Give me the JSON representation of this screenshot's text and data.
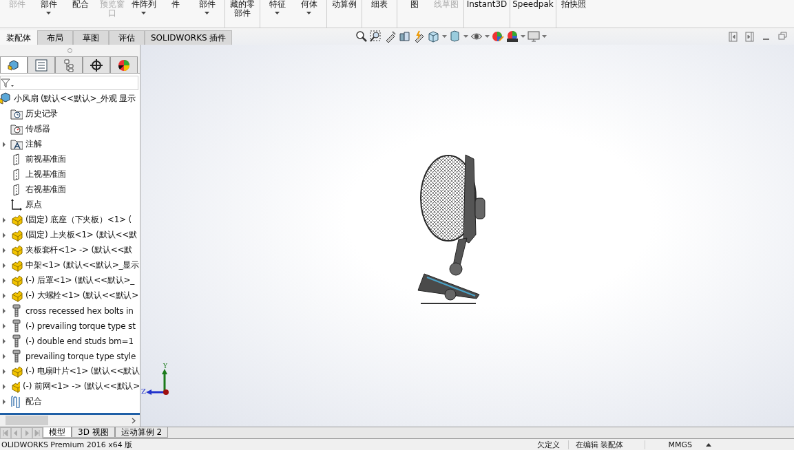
{
  "ribbon": [
    {
      "label": "部件",
      "disabled": true,
      "caret": false
    },
    {
      "label": "部件",
      "disabled": false,
      "caret": true
    },
    {
      "label": "配合",
      "disabled": false,
      "caret": false
    },
    {
      "label": "预览窗口",
      "disabled": true,
      "caret": false
    },
    {
      "label": "件阵列",
      "disabled": false,
      "caret": true
    },
    {
      "label": "件",
      "disabled": false,
      "caret": false
    },
    {
      "label": "部件",
      "disabled": false,
      "caret": true
    },
    {
      "label": "藏的零部件",
      "disabled": false,
      "caret": false
    },
    {
      "label": "特征",
      "disabled": false,
      "caret": true
    },
    {
      "label": "何体",
      "disabled": false,
      "caret": true
    },
    {
      "label": "动算例",
      "disabled": false,
      "caret": false
    },
    {
      "label": "细表",
      "disabled": false,
      "caret": false
    },
    {
      "label": "图",
      "disabled": false,
      "caret": false
    },
    {
      "label": "线草图",
      "disabled": true,
      "caret": false
    },
    {
      "label": "Instant3D",
      "disabled": false,
      "caret": false
    },
    {
      "label": "Speedpak",
      "disabled": false,
      "caret": false
    },
    {
      "label": "拍快照",
      "disabled": false,
      "caret": false
    }
  ],
  "command_tabs": [
    {
      "label": "装配体",
      "selected": true
    },
    {
      "label": "布局",
      "selected": false
    },
    {
      "label": "草图",
      "selected": false
    },
    {
      "label": "评估",
      "selected": false
    },
    {
      "label": "SOLIDWORKS 插件",
      "selected": false
    }
  ],
  "panel_tabs": [
    {
      "kind": "feature",
      "selected": true
    },
    {
      "kind": "property",
      "selected": false
    },
    {
      "kind": "config",
      "selected": false
    },
    {
      "kind": "dim",
      "selected": false
    },
    {
      "kind": "display",
      "selected": false
    }
  ],
  "tree": [
    {
      "kind": "assembly",
      "label": "小风扇  (默认<<默认>_外观 显示"
    },
    {
      "kind": "history",
      "label": "历史记录"
    },
    {
      "kind": "sensor",
      "label": "传感器"
    },
    {
      "kind": "annotation",
      "label": "注解",
      "expanded": false
    },
    {
      "kind": "plane",
      "label": "前视基准面"
    },
    {
      "kind": "plane",
      "label": "上视基准面"
    },
    {
      "kind": "plane",
      "label": "右视基准面"
    },
    {
      "kind": "origin",
      "label": "原点"
    },
    {
      "kind": "part",
      "label": "(固定) 底座（下夹板）<1> (",
      "expanded": false
    },
    {
      "kind": "part",
      "label": "(固定) 上夹板<1> (默认<<默",
      "expanded": false
    },
    {
      "kind": "part",
      "label": "夹板套杆<1> -> (默认<<默",
      "expanded": false
    },
    {
      "kind": "part",
      "label": "中架<1> (默认<<默认>_显示",
      "expanded": false
    },
    {
      "kind": "part",
      "label": "(-) 后罩<1> (默认<<默认>_",
      "expanded": false
    },
    {
      "kind": "part",
      "label": "(-) 大螺栓<1> (默认<<默认>",
      "expanded": false
    },
    {
      "kind": "bolt",
      "label": "cross recessed hex bolts in",
      "expanded": false
    },
    {
      "kind": "bolt",
      "label": "(-) prevailing torque type st",
      "expanded": false
    },
    {
      "kind": "bolt",
      "label": "(-) double end studs bm=1",
      "expanded": false
    },
    {
      "kind": "bolt",
      "label": "prevailing torque type style",
      "expanded": false
    },
    {
      "kind": "part",
      "label": "(-) 电扇叶片<1> (默认<<默认",
      "expanded": false
    },
    {
      "kind": "part",
      "label": "(-) 前网<1> -> (默认<<默认>",
      "expanded": false
    },
    {
      "kind": "mate",
      "label": "配合",
      "expanded": false
    }
  ],
  "triad": {
    "y": "Y",
    "z": "Z"
  },
  "bottom_tabs": [
    {
      "label": "模型",
      "selected": true
    },
    {
      "label": "3D 视图",
      "selected": false
    },
    {
      "label": "运动算例 2",
      "selected": false
    }
  ],
  "status_bar": [
    "OLIDWORKS Premium 2016 x64 版",
    "欠定义",
    "在编辑 装配体",
    "MMGS"
  ]
}
